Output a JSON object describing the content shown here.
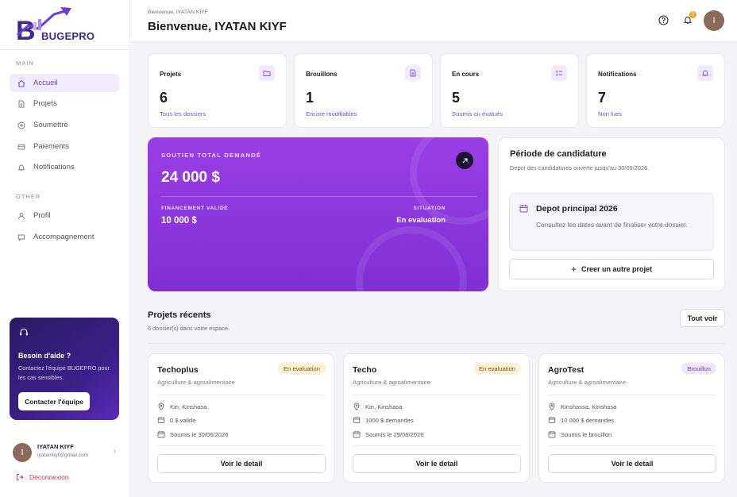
{
  "brand": {
    "logo_text": "BUGEPRO"
  },
  "sidebar": {
    "section_main": "MAIN",
    "section_other": "OTHER",
    "items": [
      {
        "label": "Accueil",
        "icon": "home-icon",
        "active": true
      },
      {
        "label": "Projets",
        "icon": "file-icon"
      },
      {
        "label": "Soumettre",
        "icon": "plus-circle-icon"
      },
      {
        "label": "Paiements",
        "icon": "card-icon"
      },
      {
        "label": "Notifications",
        "icon": "bell-icon"
      }
    ],
    "other_items": [
      {
        "label": "Profil",
        "icon": "user-icon"
      },
      {
        "label": "Accompagnement",
        "icon": "chat-icon"
      }
    ],
    "help": {
      "title": "Besoin d'aide ?",
      "text": "Contactez l'équipe BUGEPRO pour les cas sensibles.",
      "button": "Contacter l'équipe"
    },
    "user": {
      "name": "IYATAN KIYF",
      "email": "iyatankiyf@gmail.com",
      "initial": "I"
    },
    "logout": "Déconnexion"
  },
  "header": {
    "breadcrumb": "Bienvenue, IYATAN KIYF",
    "title": "Bienvenue, IYATAN KIYF",
    "notif_count": "7",
    "avatar_initial": "I"
  },
  "stats": [
    {
      "label": "Projets",
      "value": "6",
      "sub": "Tous les dossiers",
      "icon": "folder-icon"
    },
    {
      "label": "Brouillons",
      "value": "1",
      "sub": "Encore modifiables",
      "icon": "document-icon"
    },
    {
      "label": "En cours",
      "value": "5",
      "sub": "Soumis ou évalués",
      "icon": "checklist-icon"
    },
    {
      "label": "Notifications",
      "value": "7",
      "sub": "Non lues",
      "icon": "bell-icon"
    }
  ],
  "total": {
    "label": "SOUTIEN TOTAL DEMANDÉ",
    "amount": "24 000 $",
    "validated_label": "FINANCEMENT VALIDÉ",
    "validated_amount": "10 000 $",
    "situation_label": "SITUATION",
    "situation_value": "En evaluation"
  },
  "period": {
    "title": "Période de candidature",
    "desc": "Depot des candidatures ouverte jusqu'au 30/09/2026.",
    "box_title": "Depot principal 2026",
    "box_text": "Consultez les dates avant de finaliser votre dossier.",
    "button": "Creer un autre projet"
  },
  "recent": {
    "title": "Projets récents",
    "subtitle": "6 dossier(s) dans votre espace.",
    "view_all": "Tout voir",
    "projects": [
      {
        "name": "Techoplus",
        "category": "Agriculture & agroalimentaire",
        "status": "En evaluation",
        "status_type": "eval",
        "location": "Kin, Kinshasa",
        "amount": "0 $ valide",
        "date": "Soumis le 30/06/2026",
        "button": "Voir le detail"
      },
      {
        "name": "Techo",
        "category": "Agriculture & agroalimentaire",
        "status": "En evaluation",
        "status_type": "eval",
        "location": "Kin, Kinshasa",
        "amount": "1000 $ demandes",
        "date": "Soumis le 29/06/2026",
        "button": "Voir le detail"
      },
      {
        "name": "AgroTest",
        "category": "Agriculture & agroalimentaire",
        "status": "Brouillon",
        "status_type": "draft",
        "location": "Kinshassa, Kinshasa",
        "amount": "10 000 $ demandes",
        "date": "Soumis le brouillon",
        "button": "Voir le detail"
      }
    ]
  },
  "colors": {
    "accent": "#7a4fe0",
    "panel": "#8f36dd",
    "eval_badge": "#fdf1d6",
    "draft_badge": "#efe6fc",
    "logout": "#d23a3a"
  }
}
